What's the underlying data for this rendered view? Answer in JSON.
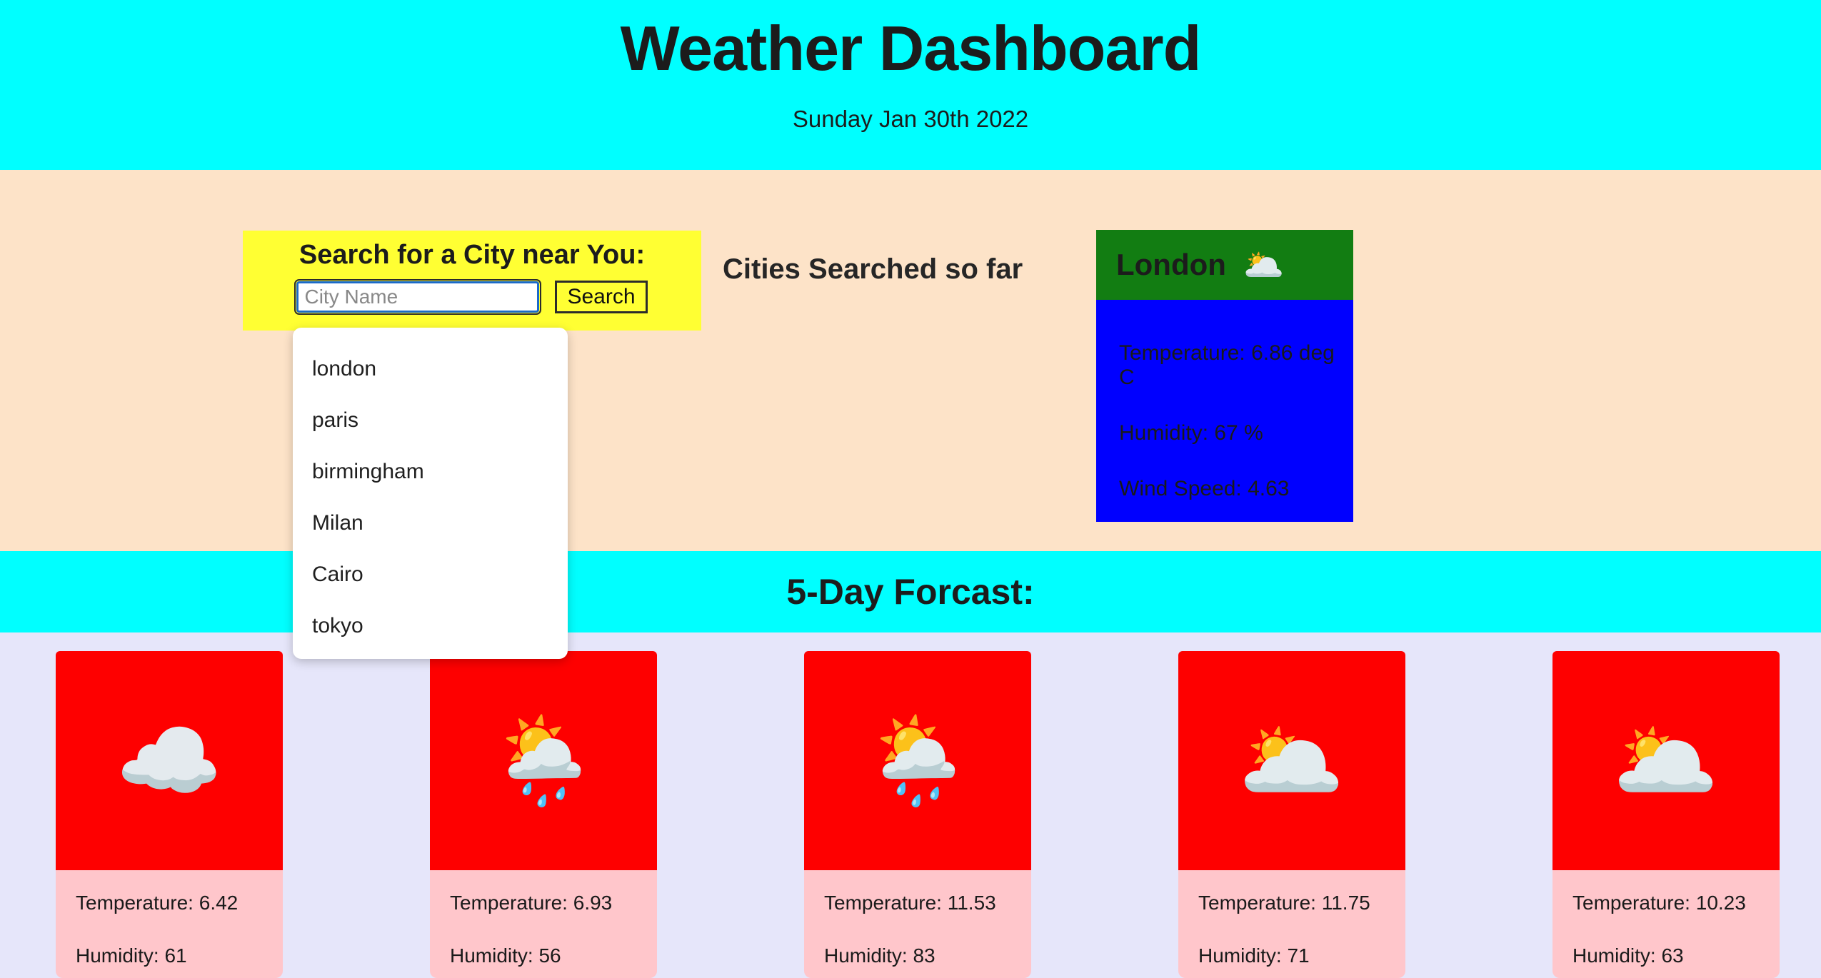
{
  "header": {
    "title": "Weather Dashboard",
    "date": "Sunday Jan 30th 2022"
  },
  "search": {
    "title": "Search for a City near You:",
    "placeholder": "City Name",
    "value": "",
    "button_label": "Search",
    "suggestions": [
      "london",
      "paris",
      "birmingham",
      "Milan",
      "Cairo",
      "tokyo"
    ]
  },
  "cities_searched": {
    "heading": "Cities Searched so far"
  },
  "current_city": {
    "name": "London",
    "icon": "broken-clouds-icon",
    "icon_glyph": "🌥️",
    "temperature": "Temperature: 6.86 deg C",
    "humidity": "Humidity: 67 %",
    "wind_speed": "Wind Speed: 4.63",
    "header_color": "#127d12",
    "body_color": "#0000ff"
  },
  "forecast": {
    "heading": "5-Day Forcast:",
    "cards": [
      {
        "icon": "cloud-icon",
        "icon_glyph": "☁️",
        "temperature": "Temperature: 6.42",
        "humidity": "Humidity: 61"
      },
      {
        "icon": "sun-behind-rain-cloud-icon",
        "icon_glyph": "🌦️",
        "temperature": "Temperature: 6.93",
        "humidity": "Humidity: 56"
      },
      {
        "icon": "sun-behind-rain-cloud-icon",
        "icon_glyph": "🌦️",
        "temperature": "Temperature: 11.53",
        "humidity": "Humidity: 83"
      },
      {
        "icon": "broken-clouds-icon",
        "icon_glyph": "🌥️",
        "temperature": "Temperature: 11.75",
        "humidity": "Humidity: 71"
      },
      {
        "icon": "broken-clouds-icon",
        "icon_glyph": "🌥️",
        "temperature": "Temperature: 10.23",
        "humidity": "Humidity: 63"
      }
    ]
  },
  "colors": {
    "header_bg": "#00ffff",
    "search_section_bg": "#fde3c8",
    "search_box_bg": "#ffff33",
    "forecast_bar_bg": "#00ffff",
    "forecast_row_bg": "#e6e6fa",
    "forecast_image_bg": "#fe0000",
    "forecast_body_bg": "#ffc6cb"
  }
}
